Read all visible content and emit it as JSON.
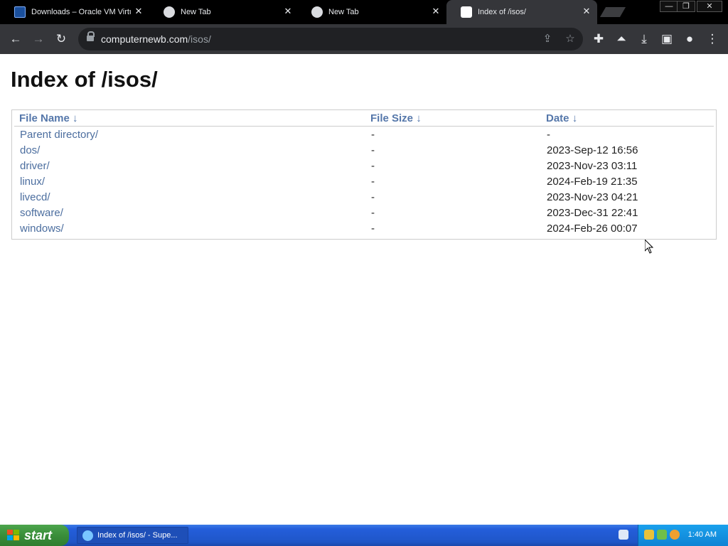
{
  "browser": {
    "tabs": [
      {
        "title": "Downloads – Oracle VM Virtu",
        "close": "✕"
      },
      {
        "title": "New Tab",
        "close": "✕"
      },
      {
        "title": "New Tab",
        "close": "✕"
      },
      {
        "title": "Index of /isos/",
        "close": "✕"
      }
    ],
    "address": {
      "host": "computernewb.com",
      "path": "/isos/"
    },
    "window_controls": {
      "minimize": "—",
      "restore": "❐",
      "close": "✕"
    }
  },
  "page": {
    "heading": "Index of /isos/",
    "columns": [
      {
        "label": "File Name",
        "sort": "↓"
      },
      {
        "label": "File Size",
        "sort": "↓"
      },
      {
        "label": "Date",
        "sort": "↓"
      }
    ],
    "rows": [
      {
        "name": "Parent directory/",
        "size": "-",
        "date": "-"
      },
      {
        "name": "dos/",
        "size": "-",
        "date": "2023-Sep-12 16:56"
      },
      {
        "name": "driver/",
        "size": "-",
        "date": "2023-Nov-23 03:11"
      },
      {
        "name": "linux/",
        "size": "-",
        "date": "2024-Feb-19 21:35"
      },
      {
        "name": "livecd/",
        "size": "-",
        "date": "2023-Nov-23 04:21"
      },
      {
        "name": "software/",
        "size": "-",
        "date": "2023-Dec-31 22:41"
      },
      {
        "name": "windows/",
        "size": "-",
        "date": "2024-Feb-26 00:07"
      }
    ]
  },
  "taskbar": {
    "start_label": "start",
    "window_item": "Index of /isos/ - Supe...",
    "clock": "1:40 AM"
  }
}
